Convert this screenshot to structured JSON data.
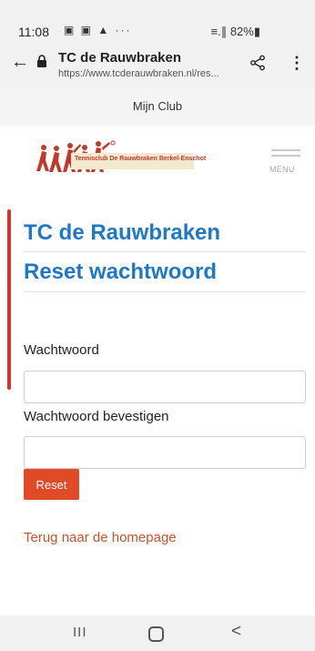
{
  "status_bar": {
    "time": "11:08",
    "icons": "▣ ▣ ▲ ···",
    "battery": "≡.∥ 82%▮"
  },
  "browser": {
    "page_title": "TC de Rauwbraken",
    "url": "https://www.tcderauwbraken.nl/res..."
  },
  "club_bar": {
    "label": "Mijn Club"
  },
  "header": {
    "logo_text": "Tennisclub De Rauwbraken Berkel-Enschot",
    "menu_label": "MENU"
  },
  "main": {
    "heading": "TC de Rauwbraken",
    "subheading": "Reset wachtwoord",
    "password_label": "Wachtwoord",
    "password_value": "",
    "confirm_label": "Wachtwoord bevestigen",
    "confirm_value": "",
    "reset_label": "Reset",
    "home_link": "Terug naar de homepage"
  },
  "navigation": {
    "recents": "III",
    "back": "<"
  },
  "colors": {
    "heading_blue": "#1e78c8",
    "accent_red": "#d6312f",
    "button_orange": "#e04a27",
    "link_orange": "#c5532a"
  }
}
